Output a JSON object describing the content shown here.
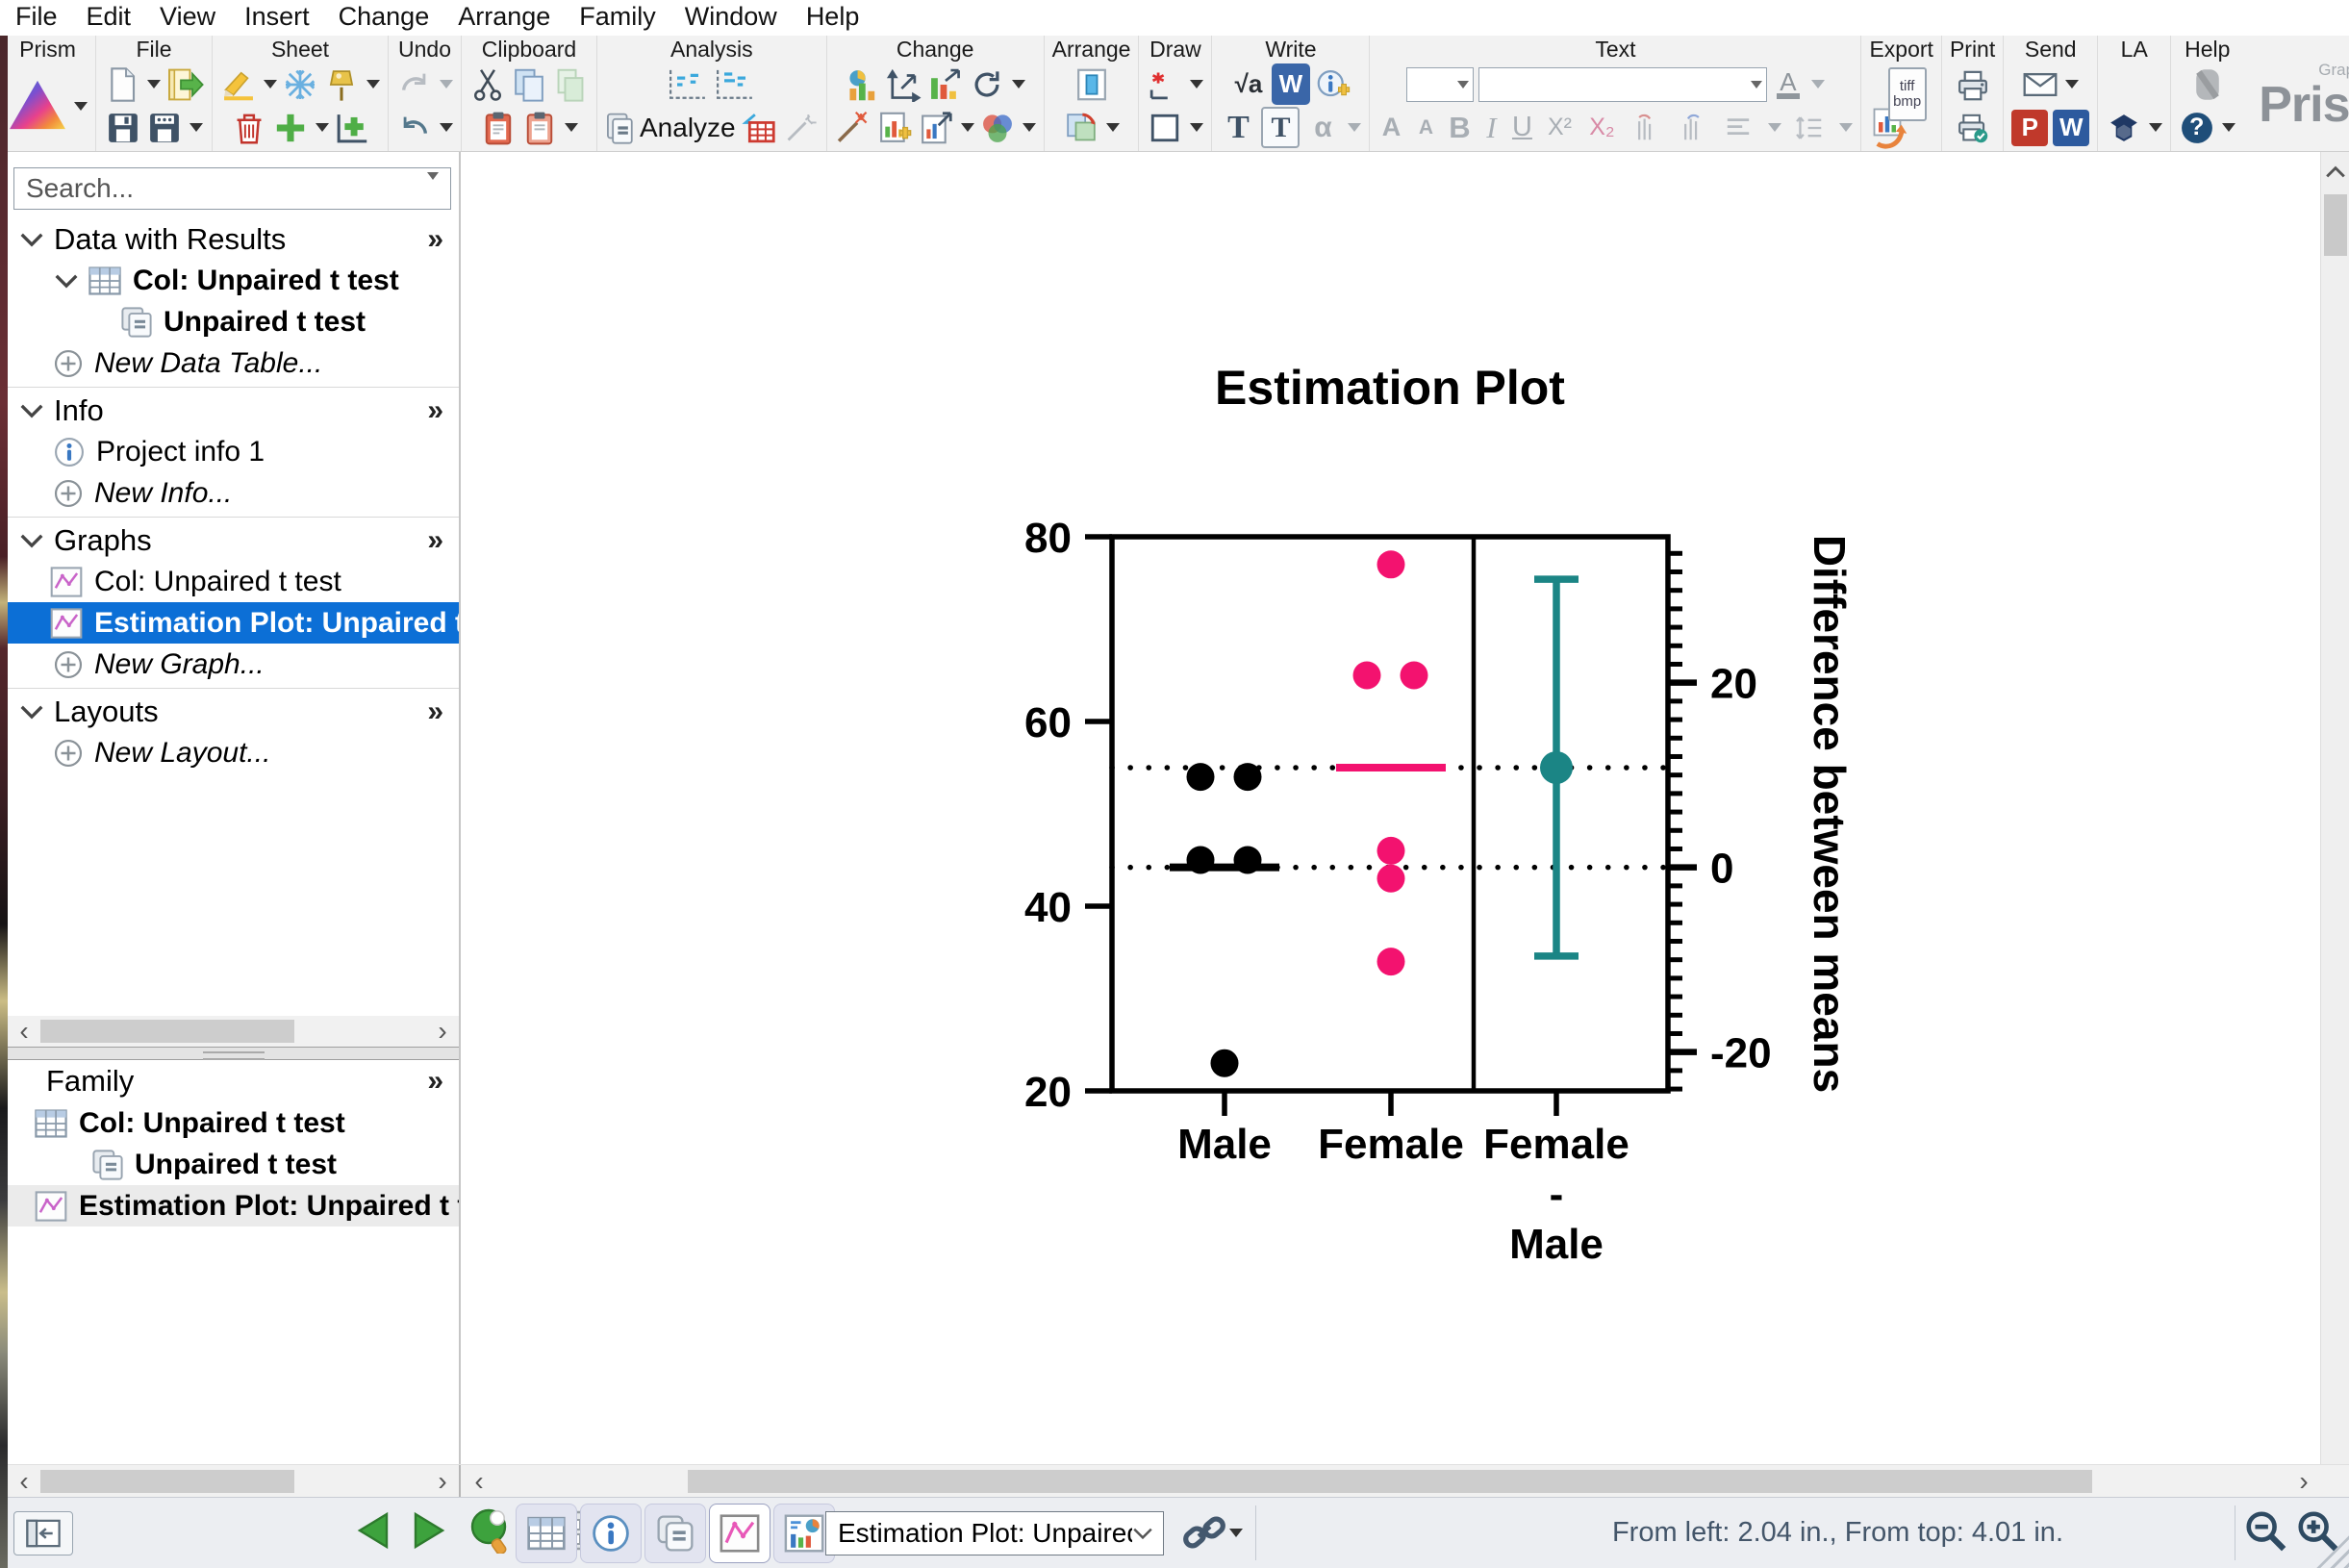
{
  "menu": {
    "items": [
      "File",
      "Edit",
      "View",
      "Insert",
      "Change",
      "Arrange",
      "Family",
      "Window",
      "Help"
    ]
  },
  "toolbar": {
    "group_labels": {
      "prism": "Prism",
      "file": "File",
      "sheet": "Sheet",
      "undo": "Undo",
      "clipboard": "Clipboard",
      "analysis": "Analysis",
      "change": "Change",
      "arrange": "Arrange",
      "draw": "Draw",
      "write": "Write",
      "text": "Text",
      "export": "Export",
      "print": "Print",
      "send": "Send",
      "la": "LA",
      "help": "Help"
    },
    "analyze_label": "Analyze",
    "export_badge_line1": "tiff",
    "export_badge_line2": "bmp",
    "glyphs": {
      "sqrt_a": "√a",
      "word_w": "W",
      "serif_t": "T",
      "boxed_t": "T",
      "alpha": "α",
      "font_up": "A",
      "font_down": "A",
      "bold_b": "B",
      "italic_i": "I",
      "underline_u": "U",
      "superscript": "X²",
      "subscript": "X₂",
      "color_a": "A",
      "ppt_p": "P",
      "word_w2": "W",
      "help_q": "?"
    },
    "brand": {
      "company": "GraphPad",
      "name": "Prism"
    }
  },
  "sidebar": {
    "search_placeholder": "Search...",
    "sections": {
      "data": {
        "title": "Data with Results"
      },
      "info": {
        "title": "Info"
      },
      "graphs": {
        "title": "Graphs"
      },
      "layouts": {
        "title": "Layouts"
      }
    },
    "items": {
      "col_table": "Col: Unpaired t test",
      "results": "Unpaired t test",
      "new_data_table": "New Data Table...",
      "project_info": "Project info 1",
      "new_info": "New Info...",
      "col_graph": "Col: Unpaired t test",
      "estimation_graph": "Estimation Plot: Unpaired t test of",
      "new_graph": "New Graph...",
      "new_layout": "New Layout..."
    },
    "family": {
      "title": "Family",
      "col_table": "Col: Unpaired t test",
      "results": "Unpaired t test",
      "estimation_graph": "Estimation Plot: Unpaired t test of"
    }
  },
  "chart_data": {
    "type": "scatter",
    "title": "Estimation Plot",
    "left_axis": {
      "range": [
        20,
        80
      ],
      "ticks": [
        80,
        60,
        40,
        20
      ]
    },
    "right_axis": {
      "label": "Difference between means",
      "ticks": [
        20,
        0,
        -20
      ],
      "minor_step": 2,
      "zero_at_left_value": 44.2
    },
    "categories": [
      "Male",
      "Female"
    ],
    "difference_label_lines": [
      "Female",
      "-",
      "Male"
    ],
    "series": [
      {
        "name": "Male",
        "color": "#000000",
        "values": [
          54,
          54,
          45,
          45,
          23
        ],
        "mean": 44.2
      },
      {
        "name": "Female",
        "color": "#F3126F",
        "values": [
          77,
          65,
          65,
          46,
          43,
          34
        ],
        "mean": 55
      }
    ],
    "difference": {
      "name": "Female - Male",
      "color": "#1B8585",
      "mean_diff": 10.8,
      "ci_low": -9.6,
      "ci_high": 31.2
    },
    "guide_lines": [
      55,
      44.2
    ],
    "grid": false,
    "legend": false
  },
  "bottombar": {
    "sheet_selector": "Estimation Plot: Unpaired t test",
    "position_status": "From left: 2.04 in., From top: 4.01 in."
  }
}
